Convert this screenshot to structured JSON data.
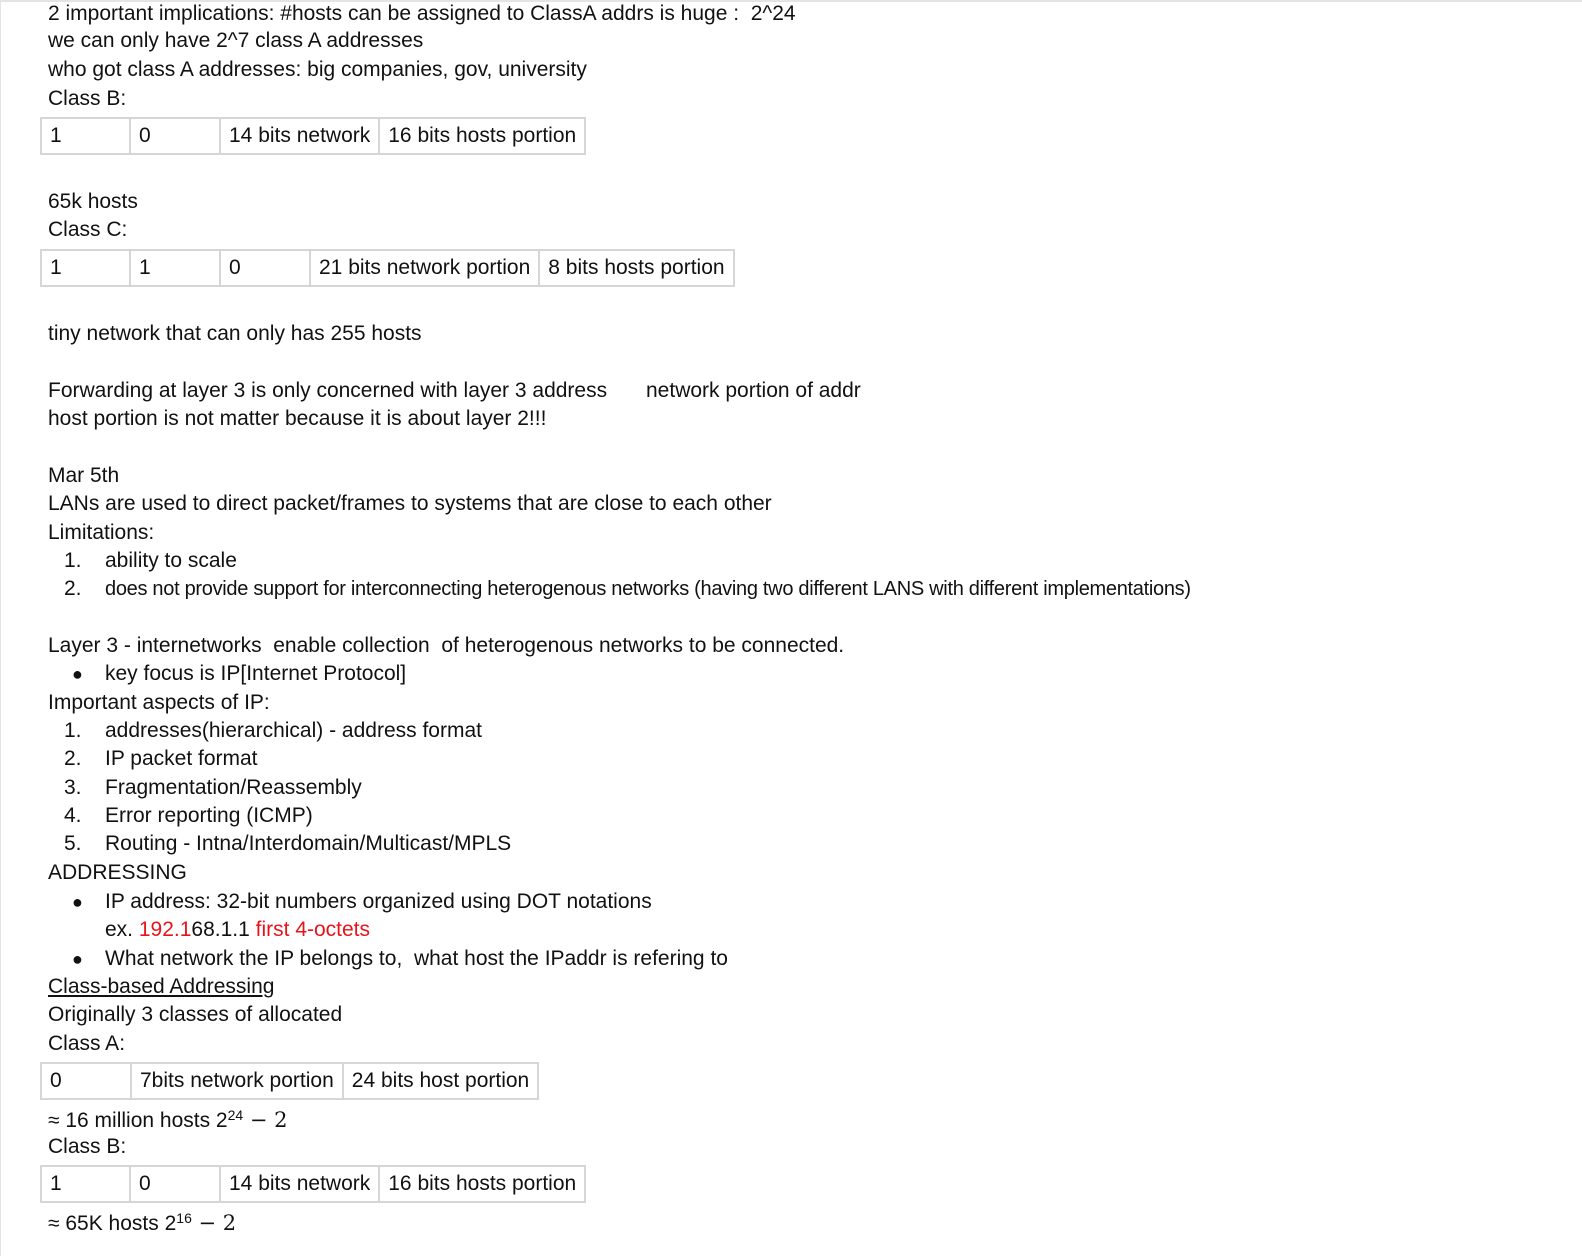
{
  "top": {
    "l1_text": "2 important implications: #hosts can be assigned to ClassA addrs is huge :  2^24",
    "l2": "we can only have 2^7 class A addresses",
    "l3": "who got class A addresses: big companies, gov, university",
    "l4": "Class B:"
  },
  "table_b1": [
    "1",
    "0",
    "14 bits network",
    "16 bits hosts portion"
  ],
  "hosts_65k": "65k hosts",
  "class_c_label": "Class C:",
  "table_c": [
    "1",
    "1",
    "0",
    "21 bits network portion",
    "8 bits hosts portion"
  ],
  "tiny_network": "tiny network that can only has 255 hosts",
  "forwarding": {
    "line1": "Forwarding at layer 3 is only concerned with layer 3 address",
    "line1_right": "network portion of addr",
    "line2": "host portion is not matter because it is about layer 2!!!"
  },
  "mar5": {
    "date": "Mar 5th",
    "lans": "LANs are used to direct packet/frames to systems that are close to each other",
    "limitations": "Limitations:",
    "items": [
      {
        "num": "1.",
        "text": "ability to scale"
      },
      {
        "num": "2.",
        "text": "does not provide support for interconnecting heterogenous networks (having two different LANS with different implementations)"
      }
    ]
  },
  "layer3": {
    "intro": "Layer 3 - internetworks  enable collection  of heterogenous networks to be connected.",
    "bullet": "key focus is IP[Internet Protocol]",
    "aspects_title": "Important aspects of IP:",
    "aspects": [
      {
        "num": "1.",
        "text": "addresses(hierarchical) - address format"
      },
      {
        "num": "2.",
        "text": "IP packet format"
      },
      {
        "num": "3.",
        "text": "Fragmentation/Reassembly"
      },
      {
        "num": "4.",
        "text": "Error reporting (ICMP)"
      },
      {
        "num": "5.",
        "text": "Routing - Intna/Interdomain/Multicast/MPLS"
      }
    ]
  },
  "addressing": {
    "title": "ADDRESSING",
    "b1": "IP address: 32-bit numbers organized using DOT notations",
    "ex_prefix": "ex. ",
    "ex_red1": "192.1",
    "ex_black": "68.1.1 ",
    "ex_red2": "first 4-octets",
    "b2": "What network the IP belongs to,  what host the IPaddr is refering to"
  },
  "class_based": {
    "heading": "Class-based Addressing",
    "originally": "Originally 3 classes of allocated",
    "class_a_label": "Class A:",
    "table_a": [
      "0",
      "7bits network portion",
      "24 bits host portion"
    ],
    "a_approx_prefix": "≈ 16 million hosts 2",
    "a_exp": "24",
    "a_suffix": " − 2",
    "class_b_label": "Class B:",
    "table_b2": [
      "1",
      "0",
      "14 bits network",
      "16 bits hosts portion"
    ],
    "b_approx_prefix": "≈ 65K hosts 2",
    "b_exp": "16",
    "b_suffix": " − 2"
  },
  "icons": {
    "bullet": "bullet-dot"
  }
}
